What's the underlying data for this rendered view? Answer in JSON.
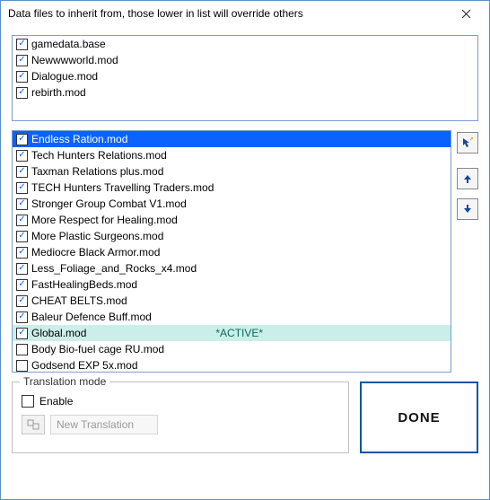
{
  "window": {
    "title": "Data files to inherit from, those lower in list will override others"
  },
  "toplist": [
    {
      "checked": true,
      "label": "gamedata.base"
    },
    {
      "checked": true,
      "label": "Newwwworld.mod"
    },
    {
      "checked": true,
      "label": "Dialogue.mod"
    },
    {
      "checked": true,
      "label": "rebirth.mod"
    }
  ],
  "modlist": [
    {
      "checked": true,
      "label": "Endless Ration.mod",
      "selected": true
    },
    {
      "checked": true,
      "label": "Tech Hunters Relations.mod"
    },
    {
      "checked": true,
      "label": "Taxman Relations plus.mod"
    },
    {
      "checked": true,
      "label": "TECH Hunters Travelling Traders.mod"
    },
    {
      "checked": true,
      "label": "Stronger Group Combat V1.mod"
    },
    {
      "checked": true,
      "label": "More Respect for Healing.mod"
    },
    {
      "checked": true,
      "label": "More Plastic Surgeons.mod"
    },
    {
      "checked": true,
      "label": "Mediocre Black Armor.mod"
    },
    {
      "checked": true,
      "label": "Less_Foliage_and_Rocks_x4.mod"
    },
    {
      "checked": true,
      "label": "FastHealingBeds.mod"
    },
    {
      "checked": true,
      "label": "CHEAT BELTS.mod"
    },
    {
      "checked": true,
      "label": "Baleur Defence Buff.mod"
    },
    {
      "checked": true,
      "label": "Global.mod",
      "active_text": "*ACTIVE*",
      "active": true
    },
    {
      "checked": false,
      "label": "Body Bio-fuel cage RU.mod"
    },
    {
      "checked": false,
      "label": "Godsend EXP 5x.mod"
    }
  ],
  "translation": {
    "legend": "Translation mode",
    "enable_label": "Enable",
    "new_translation": "New Translation"
  },
  "buttons": {
    "done": "DONE"
  }
}
